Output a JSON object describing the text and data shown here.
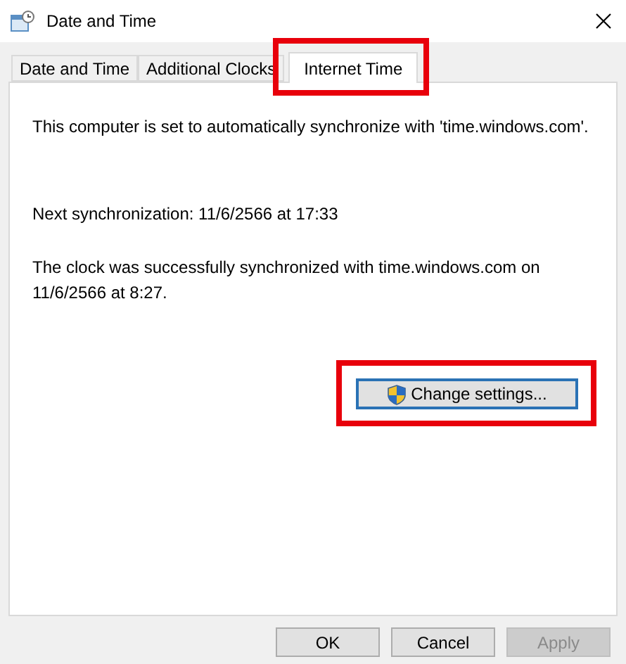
{
  "window": {
    "title": "Date and Time"
  },
  "tabs": [
    {
      "label": "Date and Time",
      "selected": false,
      "highlighted": false
    },
    {
      "label": "Additional Clocks",
      "selected": false,
      "highlighted": false
    },
    {
      "label": "Internet Time",
      "selected": true,
      "highlighted": true
    }
  ],
  "status_text": "This computer is set to automatically synchronize with 'time.windows.com'.",
  "next_sync": "Next synchronization: 11/6/2566 at 17:33",
  "last_sync": "The clock was successfully synchronized with time.windows.com on 11/6/2566 at 8:27.",
  "change_button": {
    "label": "Change settings...",
    "highlighted": true
  },
  "buttons": [
    {
      "label": "OK",
      "disabled": false
    },
    {
      "label": "Cancel",
      "disabled": false
    },
    {
      "label": "Apply",
      "disabled": true
    }
  ]
}
